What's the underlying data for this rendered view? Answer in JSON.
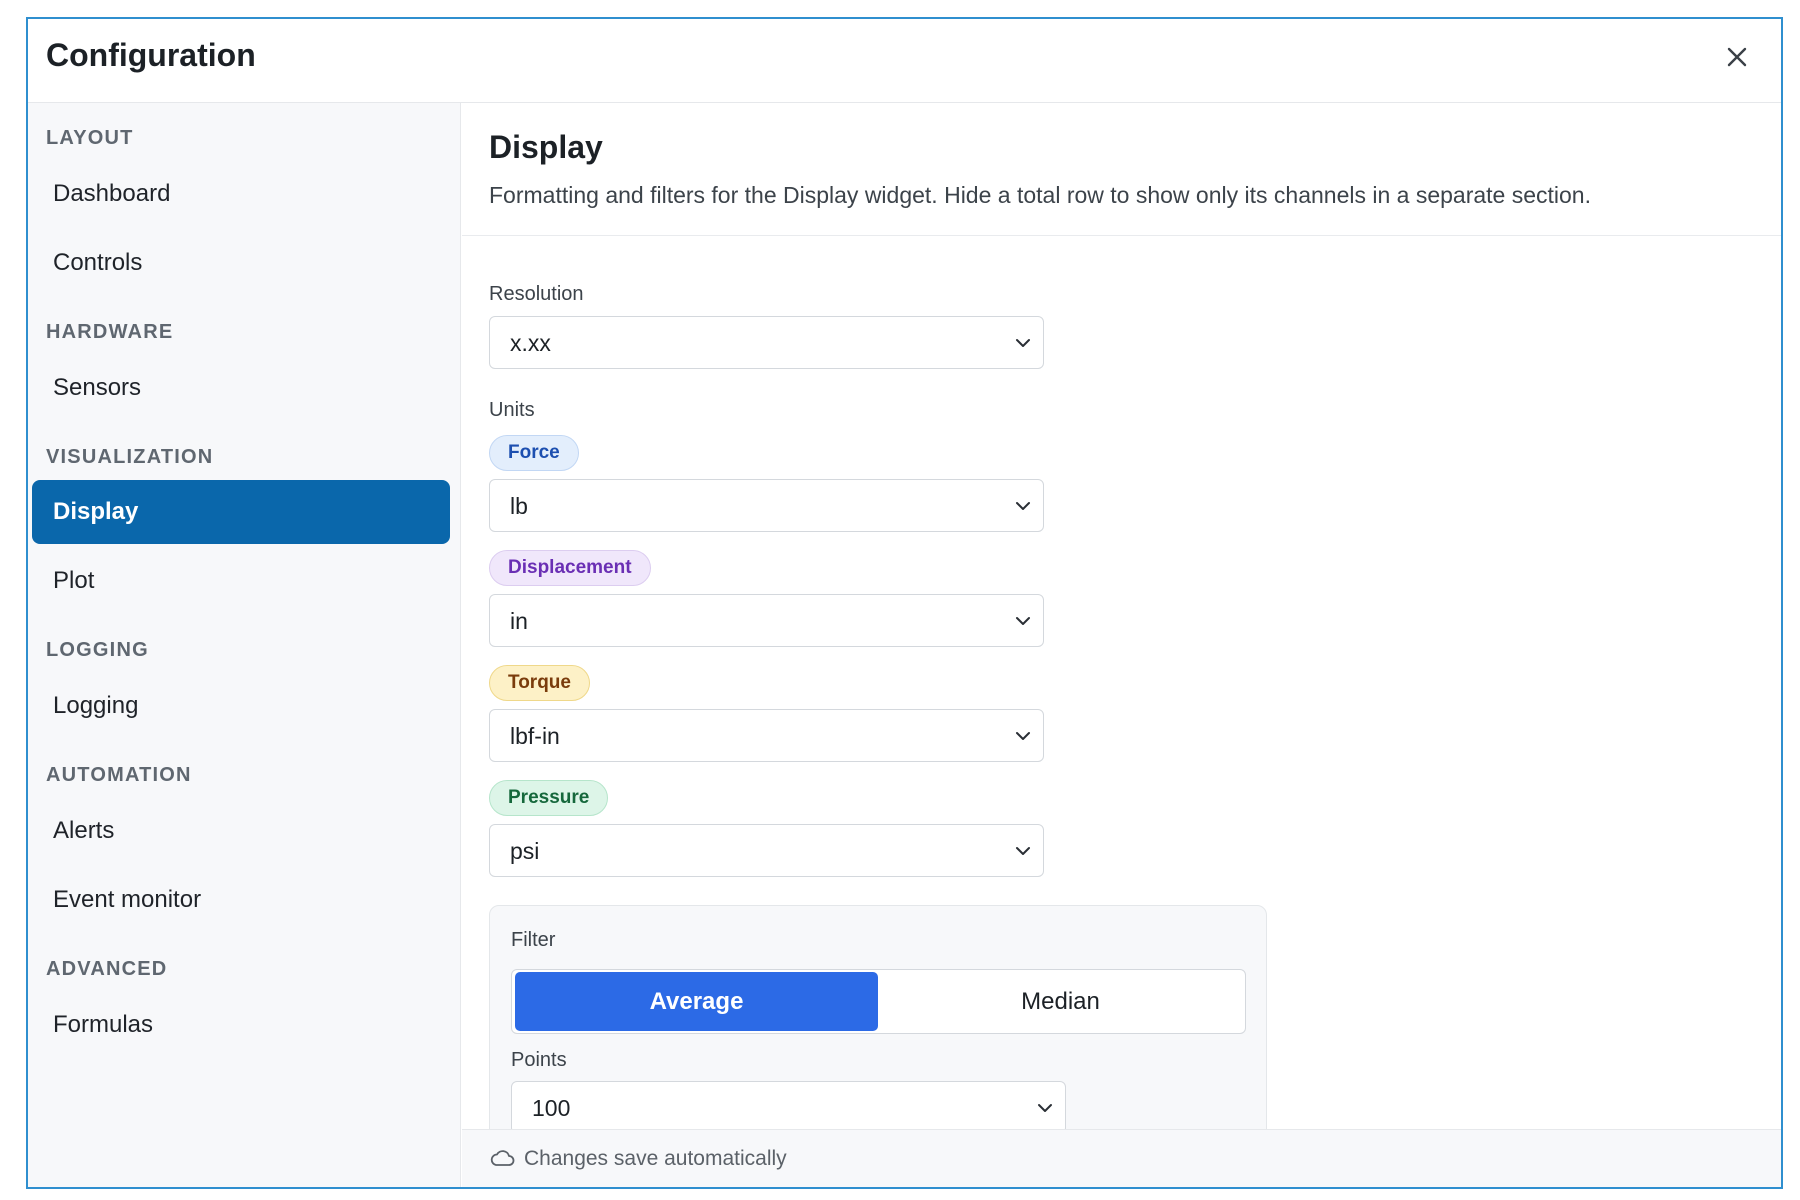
{
  "dialog": {
    "title": "Configuration",
    "close_icon": "close-icon"
  },
  "sidebar": {
    "sections": [
      {
        "label": "LAYOUT",
        "items": [
          "Dashboard",
          "Controls"
        ]
      },
      {
        "label": "HARDWARE",
        "items": [
          "Sensors"
        ]
      },
      {
        "label": "VISUALIZATION",
        "items": [
          "Display",
          "Plot"
        ]
      },
      {
        "label": "LOGGING",
        "items": [
          "Logging"
        ]
      },
      {
        "label": "AUTOMATION",
        "items": [
          "Alerts",
          "Event monitor"
        ]
      },
      {
        "label": "ADVANCED",
        "items": [
          "Formulas"
        ]
      }
    ],
    "active_item": "Display",
    "active_color": "#0a67ab"
  },
  "content": {
    "title": "Display",
    "description": "Formatting and filters for the Display widget. Hide a total row to show only its channels in a separate section.",
    "resolution": {
      "label": "Resolution",
      "value": "x.xx"
    },
    "units": {
      "label": "Units",
      "items": [
        {
          "chip": "Force",
          "value": "lb",
          "color": "#1d4fb0"
        },
        {
          "chip": "Displacement",
          "value": "in",
          "color": "#6a2fb4"
        },
        {
          "chip": "Torque",
          "value": "lbf-in",
          "color": "#7a3c0c"
        },
        {
          "chip": "Pressure",
          "value": "psi",
          "color": "#16683c"
        }
      ]
    },
    "filter": {
      "label": "Filter",
      "options": [
        "Average",
        "Median"
      ],
      "selected": "Average",
      "accent": "#2c6ae6",
      "points_label": "Points",
      "points_value": "100"
    }
  },
  "footer": {
    "status_icon": "cloud-icon",
    "text": "Changes save automatically"
  }
}
